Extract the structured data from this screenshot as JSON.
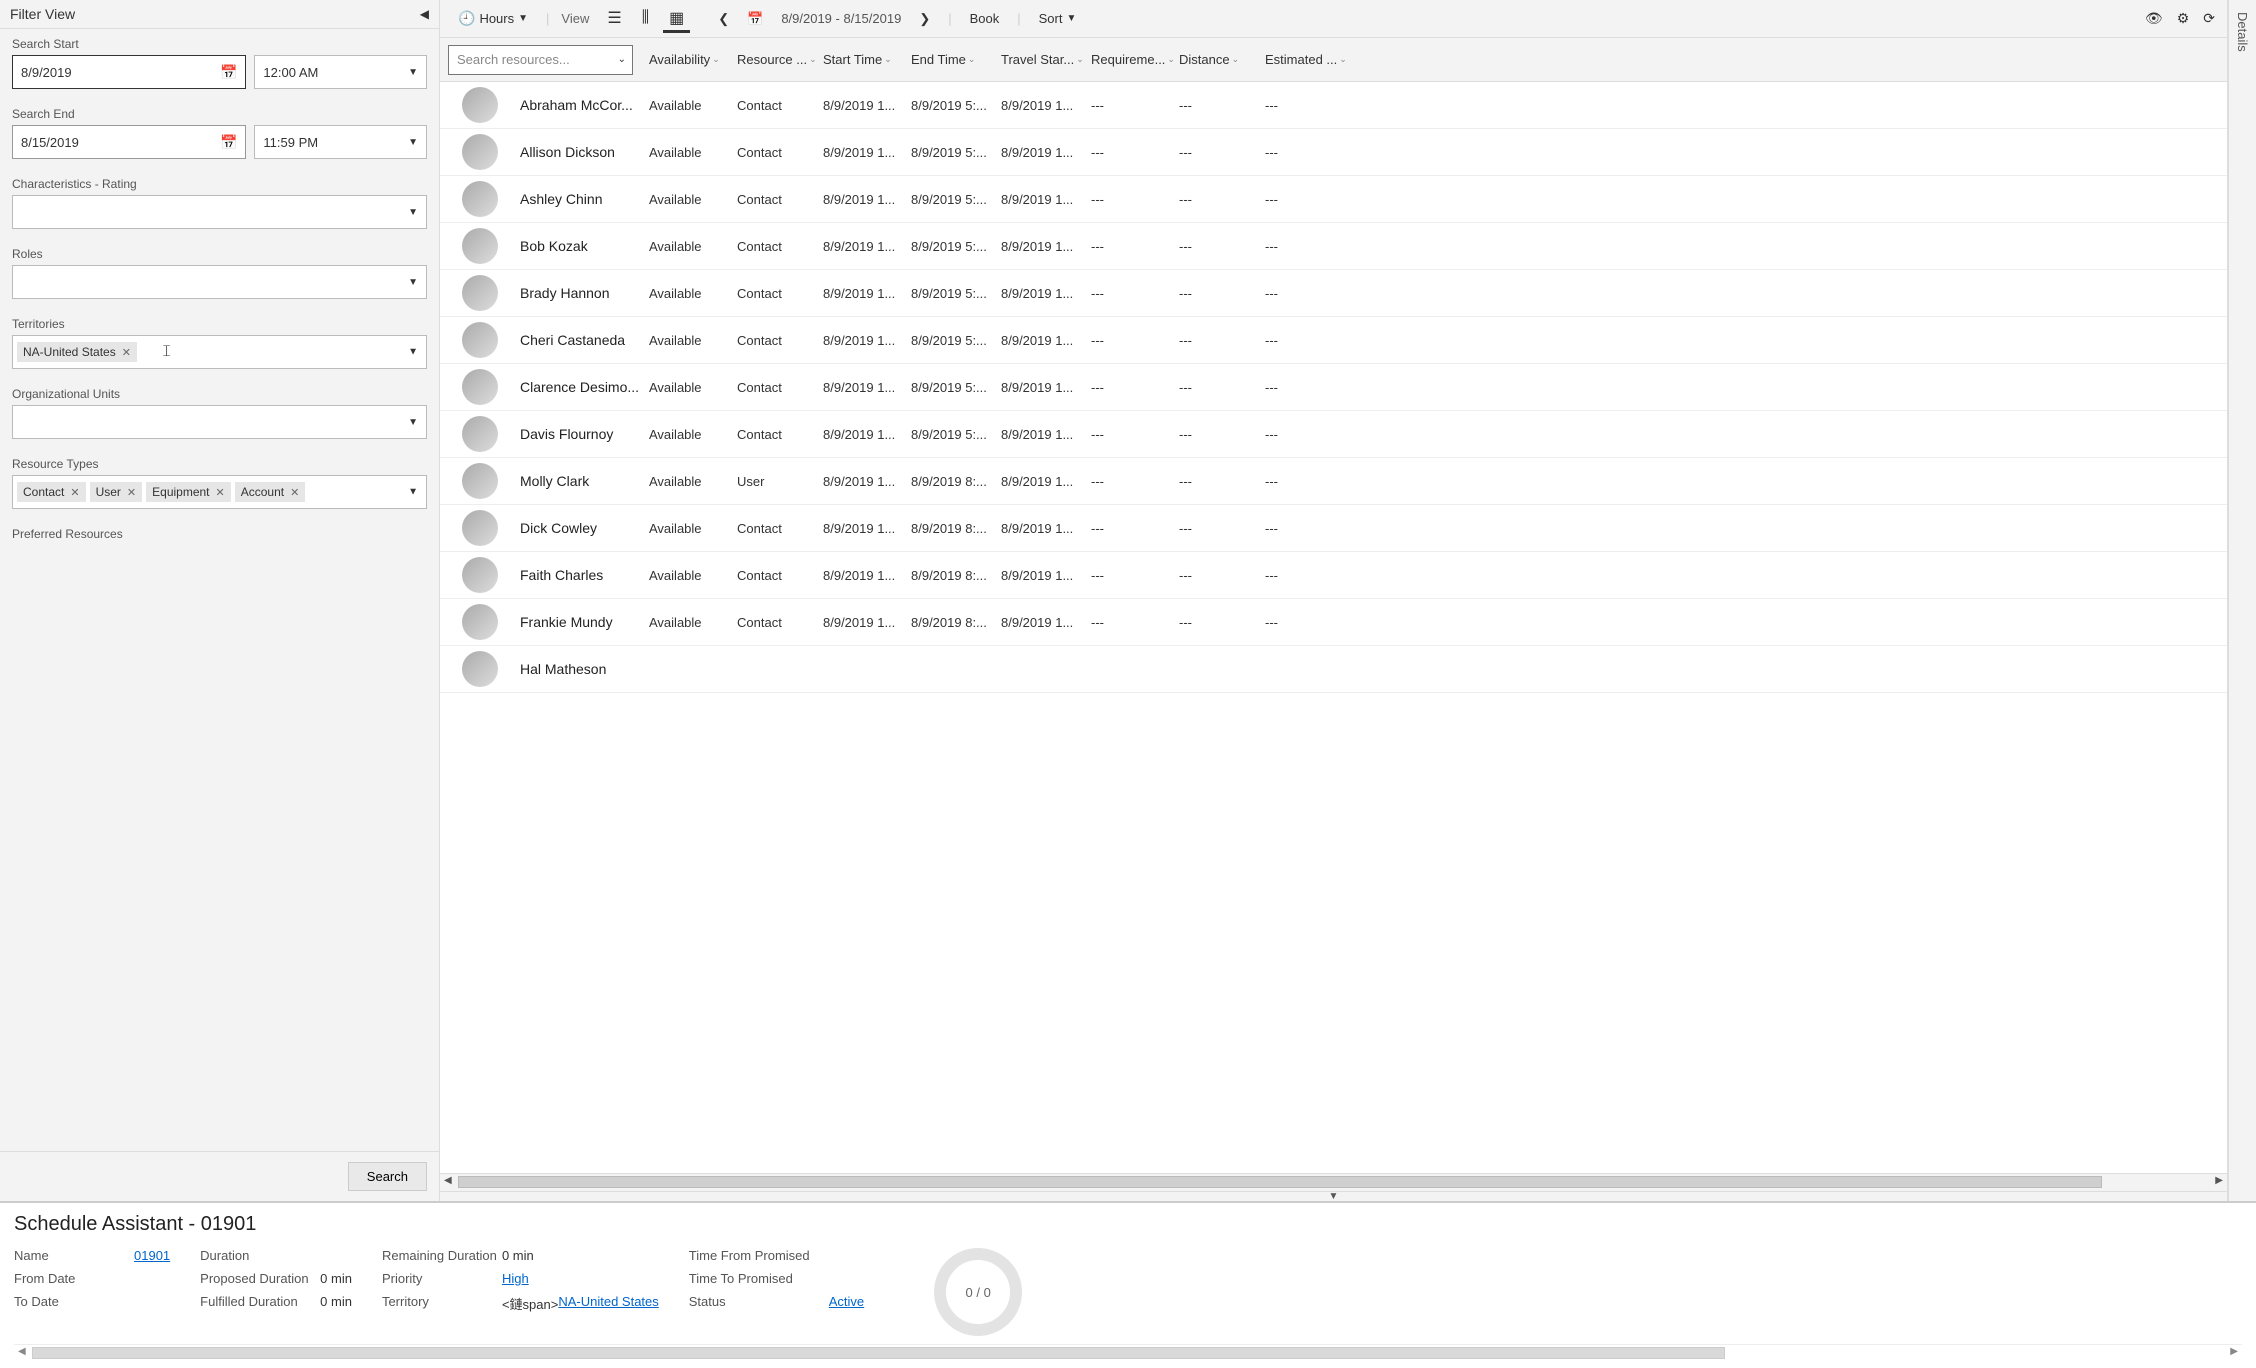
{
  "filter": {
    "title": "Filter View",
    "search_start_label": "Search Start",
    "search_start_date": "8/9/2019",
    "search_start_time": "12:00 AM",
    "search_end_label": "Search End",
    "search_end_date": "8/15/2019",
    "search_end_time": "11:59 PM",
    "characteristics_label": "Characteristics - Rating",
    "roles_label": "Roles",
    "territories_label": "Territories",
    "territories_tags": [
      "NA-United States"
    ],
    "org_units_label": "Organizational Units",
    "resource_types_label": "Resource Types",
    "resource_types_tags": [
      "Contact",
      "User",
      "Equipment",
      "Account"
    ],
    "preferred_label": "Preferred Resources",
    "search_button": "Search"
  },
  "toolbar": {
    "hours_label": "Hours",
    "view_label": "View",
    "date_range": "8/9/2019 - 8/15/2019",
    "book_label": "Book",
    "sort_label": "Sort"
  },
  "grid": {
    "search_placeholder": "Search resources...",
    "columns": {
      "availability": "Availability",
      "resource": "Resource ...",
      "start": "Start Time",
      "end": "End Time",
      "travel": "Travel Star...",
      "req": "Requireme...",
      "distance": "Distance",
      "estimated": "Estimated ..."
    },
    "rows": [
      {
        "name": "Abraham McCor...",
        "avail": "Available",
        "res": "Contact",
        "start": "8/9/2019 1...",
        "end": "8/9/2019 5:...",
        "travel": "8/9/2019 1...",
        "req": "---",
        "dist": "---",
        "est": "---"
      },
      {
        "name": "Allison Dickson",
        "avail": "Available",
        "res": "Contact",
        "start": "8/9/2019 1...",
        "end": "8/9/2019 5:...",
        "travel": "8/9/2019 1...",
        "req": "---",
        "dist": "---",
        "est": "---"
      },
      {
        "name": "Ashley Chinn",
        "avail": "Available",
        "res": "Contact",
        "start": "8/9/2019 1...",
        "end": "8/9/2019 5:...",
        "travel": "8/9/2019 1...",
        "req": "---",
        "dist": "---",
        "est": "---"
      },
      {
        "name": "Bob Kozak",
        "avail": "Available",
        "res": "Contact",
        "start": "8/9/2019 1...",
        "end": "8/9/2019 5:...",
        "travel": "8/9/2019 1...",
        "req": "---",
        "dist": "---",
        "est": "---"
      },
      {
        "name": "Brady Hannon",
        "avail": "Available",
        "res": "Contact",
        "start": "8/9/2019 1...",
        "end": "8/9/2019 5:...",
        "travel": "8/9/2019 1...",
        "req": "---",
        "dist": "---",
        "est": "---"
      },
      {
        "name": "Cheri Castaneda",
        "avail": "Available",
        "res": "Contact",
        "start": "8/9/2019 1...",
        "end": "8/9/2019 5:...",
        "travel": "8/9/2019 1...",
        "req": "---",
        "dist": "---",
        "est": "---"
      },
      {
        "name": "Clarence Desimo...",
        "avail": "Available",
        "res": "Contact",
        "start": "8/9/2019 1...",
        "end": "8/9/2019 5:...",
        "travel": "8/9/2019 1...",
        "req": "---",
        "dist": "---",
        "est": "---"
      },
      {
        "name": "Davis Flournoy",
        "avail": "Available",
        "res": "Contact",
        "start": "8/9/2019 1...",
        "end": "8/9/2019 5:...",
        "travel": "8/9/2019 1...",
        "req": "---",
        "dist": "---",
        "est": "---"
      },
      {
        "name": "Molly Clark",
        "avail": "Available",
        "res": "User",
        "start": "8/9/2019 1...",
        "end": "8/9/2019 8:...",
        "travel": "8/9/2019 1...",
        "req": "---",
        "dist": "---",
        "est": "---"
      },
      {
        "name": "Dick Cowley",
        "avail": "Available",
        "res": "Contact",
        "start": "8/9/2019 1...",
        "end": "8/9/2019 8:...",
        "travel": "8/9/2019 1...",
        "req": "---",
        "dist": "---",
        "est": "---"
      },
      {
        "name": "Faith Charles",
        "avail": "Available",
        "res": "Contact",
        "start": "8/9/2019 1...",
        "end": "8/9/2019 8:...",
        "travel": "8/9/2019 1...",
        "req": "---",
        "dist": "---",
        "est": "---"
      },
      {
        "name": "Frankie Mundy",
        "avail": "Available",
        "res": "Contact",
        "start": "8/9/2019 1...",
        "end": "8/9/2019 8:...",
        "travel": "8/9/2019 1...",
        "req": "---",
        "dist": "---",
        "est": "---"
      },
      {
        "name": "Hal Matheson",
        "avail": "",
        "res": "",
        "start": "",
        "end": "",
        "travel": "",
        "req": "",
        "dist": "",
        "est": ""
      }
    ]
  },
  "details_rail": "Details",
  "bottom": {
    "title": "Schedule Assistant - 01901",
    "name_label": "Name",
    "name_value": "01901",
    "from_label": "From Date",
    "from_value": "",
    "to_label": "To Date",
    "to_value": "",
    "duration_label": "Duration",
    "duration_value": "",
    "proposed_label": "Proposed Duration",
    "proposed_value": "0 min",
    "fulfilled_label": "Fulfilled Duration",
    "fulfilled_value": "0 min",
    "remaining_label": "Remaining Duration",
    "remaining_value": "0 min",
    "priority_label": "Priority",
    "priority_value": "High",
    "territory_label": "Territory",
    "territory_value": "NA-United States",
    "time_from_label": "Time From Promised",
    "time_from_value": "",
    "time_to_label": "Time To Promised",
    "time_to_value": "",
    "status_label": "Status",
    "status_value": "Active",
    "ring_text": "0 / 0"
  }
}
